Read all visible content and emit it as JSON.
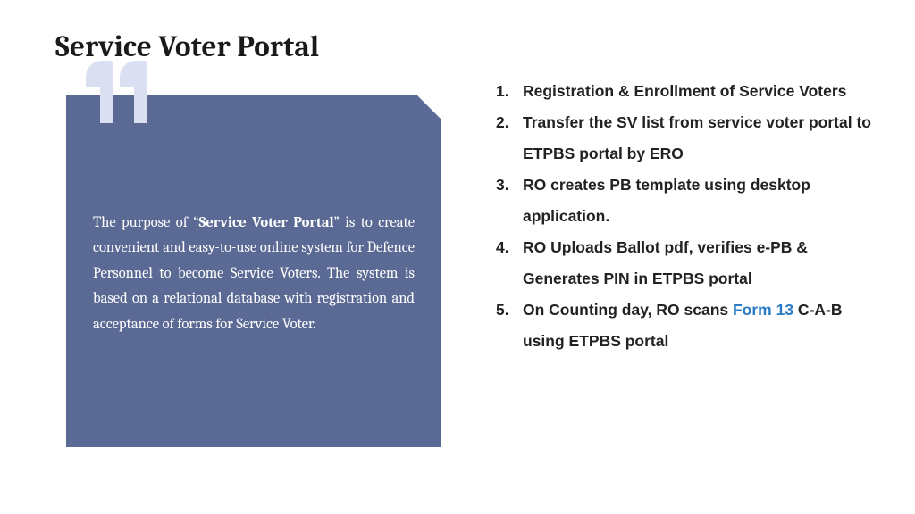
{
  "title": "Service Voter Portal",
  "quote": {
    "prefix": "The purpose of “",
    "bold": "Service Voter Portal",
    "suffix": "” is to create convenient and easy-to-use online system for Defence Personnel to become Service Voters. The system is based on a relational database with registration and acceptance of forms for Service Voter."
  },
  "items": [
    {
      "n": "1.",
      "text": "Registration & Enrollment of Service Voters"
    },
    {
      "n": "2.",
      "text": "Transfer the SV list from service voter portal to ETPBS portal by ERO"
    },
    {
      "n": "3.",
      "text": "RO creates PB template using desktop application."
    },
    {
      "n": "4.",
      "text": "RO Uploads Ballot pdf, verifies e-PB & Generates PIN in ETPBS portal"
    },
    {
      "n": "5.",
      "pre": "On Counting day, RO scans ",
      "link": "Form 13",
      "post": " C-A-B using ETPBS portal"
    }
  ]
}
